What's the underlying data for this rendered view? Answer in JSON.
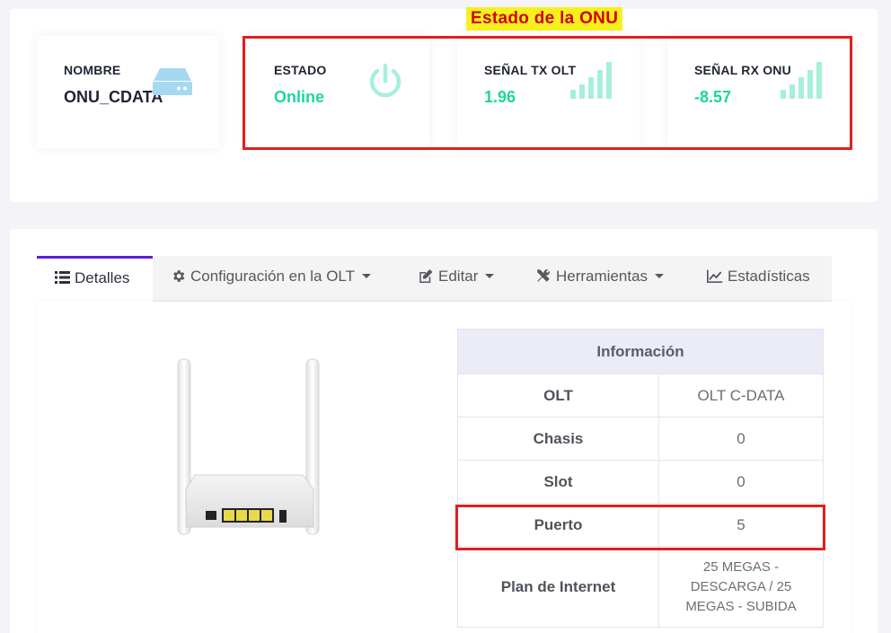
{
  "annotation": {
    "title": "Estado de la ONU"
  },
  "cards": {
    "nombre": {
      "label": "NOMBRE",
      "value": "ONU_CDATA",
      "icon": "server-icon"
    },
    "estado": {
      "label": "ESTADO",
      "value": "Online",
      "icon": "power-icon"
    },
    "tx": {
      "label": "SEÑAL TX OLT",
      "value": "1.96",
      "icon": "signal-bars-icon"
    },
    "rx": {
      "label": "SEÑAL RX ONU",
      "value": "-8.57",
      "icon": "signal-bars-icon"
    }
  },
  "tabs": [
    {
      "label": "Detalles",
      "icon": "list-icon",
      "active": true
    },
    {
      "label": "Configuración en la OLT",
      "icon": "gear-icon",
      "dropdown": true
    },
    {
      "label": "Editar",
      "icon": "edit-icon",
      "dropdown": true
    },
    {
      "label": "Herramientas",
      "icon": "tools-icon",
      "dropdown": true
    },
    {
      "label": "Estadísticas",
      "icon": "chart-icon"
    }
  ],
  "info_table": {
    "header": "Información",
    "rows": [
      {
        "key": "OLT",
        "value": "OLT C-DATA"
      },
      {
        "key": "Chasis",
        "value": "0"
      },
      {
        "key": "Slot",
        "value": "0"
      },
      {
        "key": "Puerto",
        "value": "5"
      },
      {
        "key": "Plan de Internet",
        "value": "25 MEGAS - DESCARGA / 25 MEGAS - SUBIDA"
      }
    ]
  },
  "colors": {
    "accent": "#5a1fdc",
    "online_green": "#1cd6a0",
    "icon_light": "#a6efdc",
    "annotation_red": "#e01f1f",
    "annotation_yellow": "#f8f01e"
  }
}
